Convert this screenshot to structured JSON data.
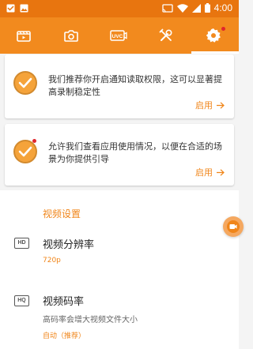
{
  "status_bar": {
    "time": "4:00",
    "icons": [
      "notification-box-icon",
      "image-icon",
      "cast-icon",
      "wifi-icon",
      "signal-icon",
      "battery-icon"
    ]
  },
  "tabs": [
    {
      "name": "video-list",
      "icon": "clapperboard-icon"
    },
    {
      "name": "screenshot",
      "icon": "camera-icon"
    },
    {
      "name": "facecam",
      "icon": "uvc-camera-icon",
      "icon_text": "UVC"
    },
    {
      "name": "tools",
      "icon": "tools-icon"
    },
    {
      "name": "settings",
      "icon": "gear-icon",
      "selected": true,
      "badge": true
    }
  ],
  "cards": [
    {
      "text": "我们推荐你开启通知读取权限，这可以显著提高录制稳定性",
      "action": "启用",
      "badge": false
    },
    {
      "text": "允许我们查看应用使用情况，以便在合适的场景为你提供引导",
      "action": "启用",
      "badge": true
    }
  ],
  "settings": {
    "section_title": "视频设置",
    "items": [
      {
        "icon_text": "HD",
        "title": "视频分辨率",
        "subtitle": "",
        "value": "720p"
      },
      {
        "icon_text": "HQ",
        "title": "视频码率",
        "subtitle": "高码率会增大视频文件大小",
        "value": "自动（推荐）"
      }
    ]
  },
  "colors": {
    "status_bar": "#e8750f",
    "tab_bar": "#f28a1e",
    "accent": "#f08519",
    "badge": "#e0262c"
  }
}
